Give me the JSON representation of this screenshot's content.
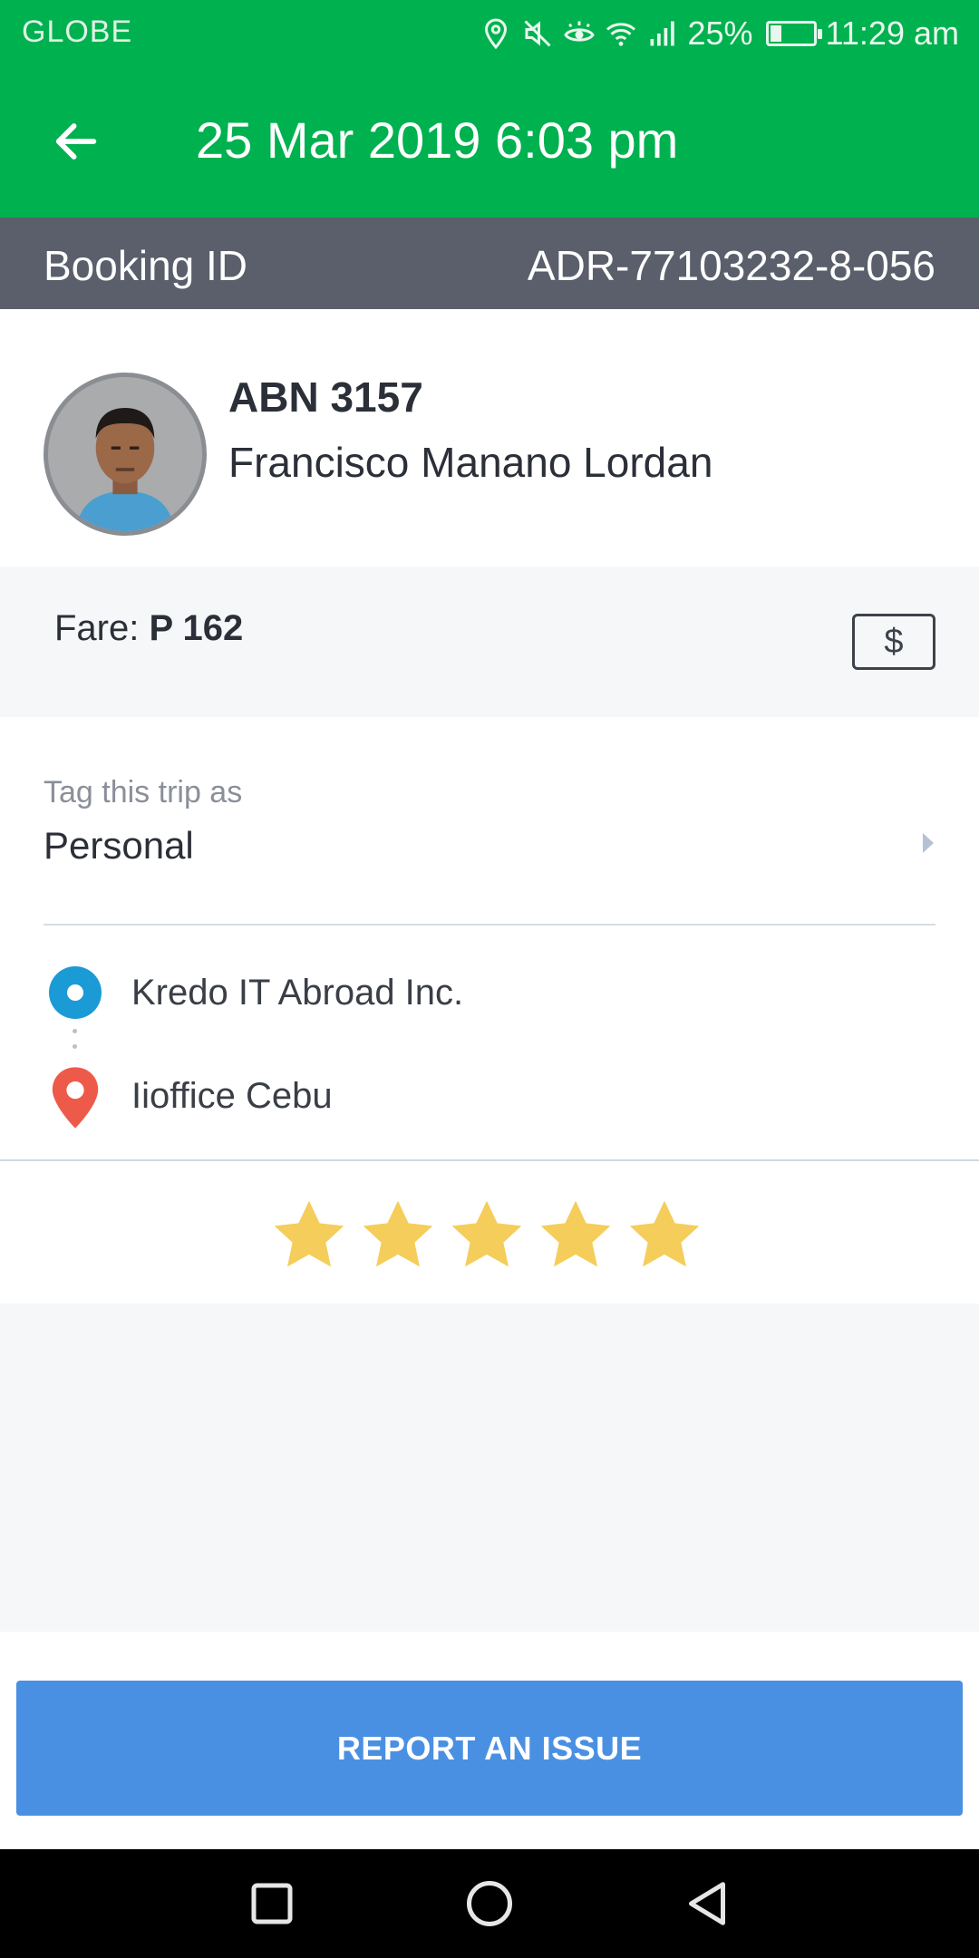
{
  "status_bar": {
    "carrier": "GLOBE",
    "battery_percent": "25%",
    "battery_level": 0.25,
    "time": "11:29 am",
    "icons": [
      "location-icon",
      "mute-icon",
      "eye-comfort-icon",
      "wifi-icon",
      "signal-icon",
      "battery-icon"
    ]
  },
  "header": {
    "back_icon": "arrow-left-icon",
    "title": "25 Mar 2019 6:03 pm"
  },
  "booking": {
    "label": "Booking ID",
    "id": "ADR-77103232-8-056"
  },
  "driver": {
    "plate": "ABN 3157",
    "name": "Francisco Manano Lordan"
  },
  "fare": {
    "label": "Fare:",
    "amount": "P 162",
    "payment_icon": "$"
  },
  "tag": {
    "label": "Tag this trip as",
    "value": "Personal"
  },
  "route": {
    "pickup": "Kredo IT Abroad Inc.",
    "dropoff": "Iioffice Cebu"
  },
  "rating": {
    "stars": 5,
    "max": 5,
    "color": "#f5cd5b"
  },
  "actions": {
    "report_label": "REPORT AN ISSUE"
  },
  "colors": {
    "brand_green": "#00b14f",
    "booking_bar": "#5a5f6b",
    "report_blue": "#4a90e2",
    "pickup_blue": "#1a9bd6",
    "dropoff_red": "#ee5a4a"
  }
}
